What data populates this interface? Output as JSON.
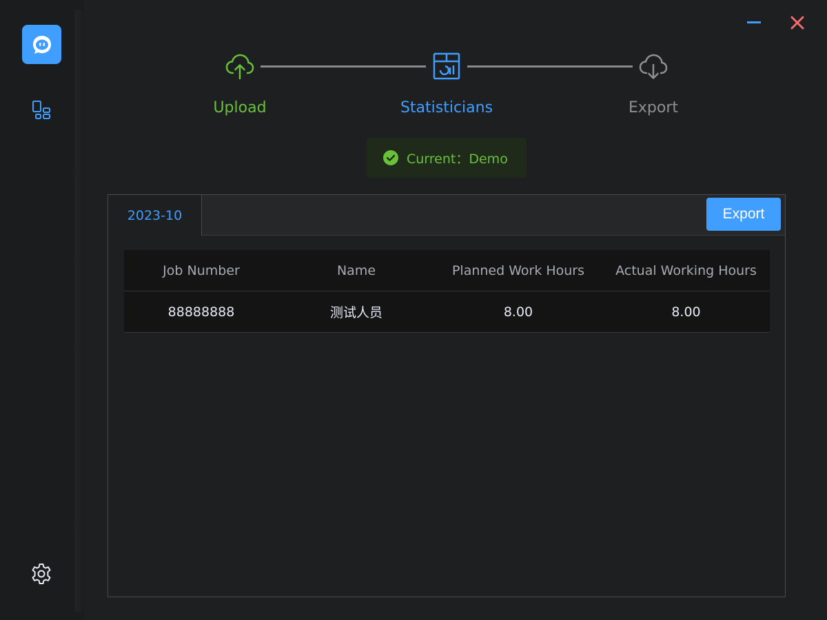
{
  "sidebar": {
    "logo_icon": "chat-bubble-robot-icon",
    "nav_icon": "layout-grid-icon",
    "settings_icon": "gear-icon"
  },
  "window": {
    "minimize_icon": "minus-icon",
    "close_icon": "close-icon"
  },
  "steps": [
    {
      "label": "Upload",
      "icon": "cloud-upload-icon",
      "color": "#67c23a"
    },
    {
      "label": "Statisticians",
      "icon": "chart-table-icon",
      "color": "#409eff"
    },
    {
      "label": "Export",
      "icon": "cloud-download-icon",
      "color": "#8f9093"
    }
  ],
  "current": {
    "text": "Current：Demo",
    "icon": "check-circle-icon"
  },
  "panel": {
    "active_tab": "2023-10",
    "export_label": "Export"
  },
  "table": {
    "columns": [
      "Job Number",
      "Name",
      "Planned Work Hours",
      "Actual Working Hours"
    ],
    "rows": [
      [
        "88888888",
        "测试人员",
        "8.00",
        "8.00"
      ]
    ]
  },
  "colors": {
    "accent": "#409eff",
    "success": "#67c23a",
    "danger": "#f56c6c"
  }
}
